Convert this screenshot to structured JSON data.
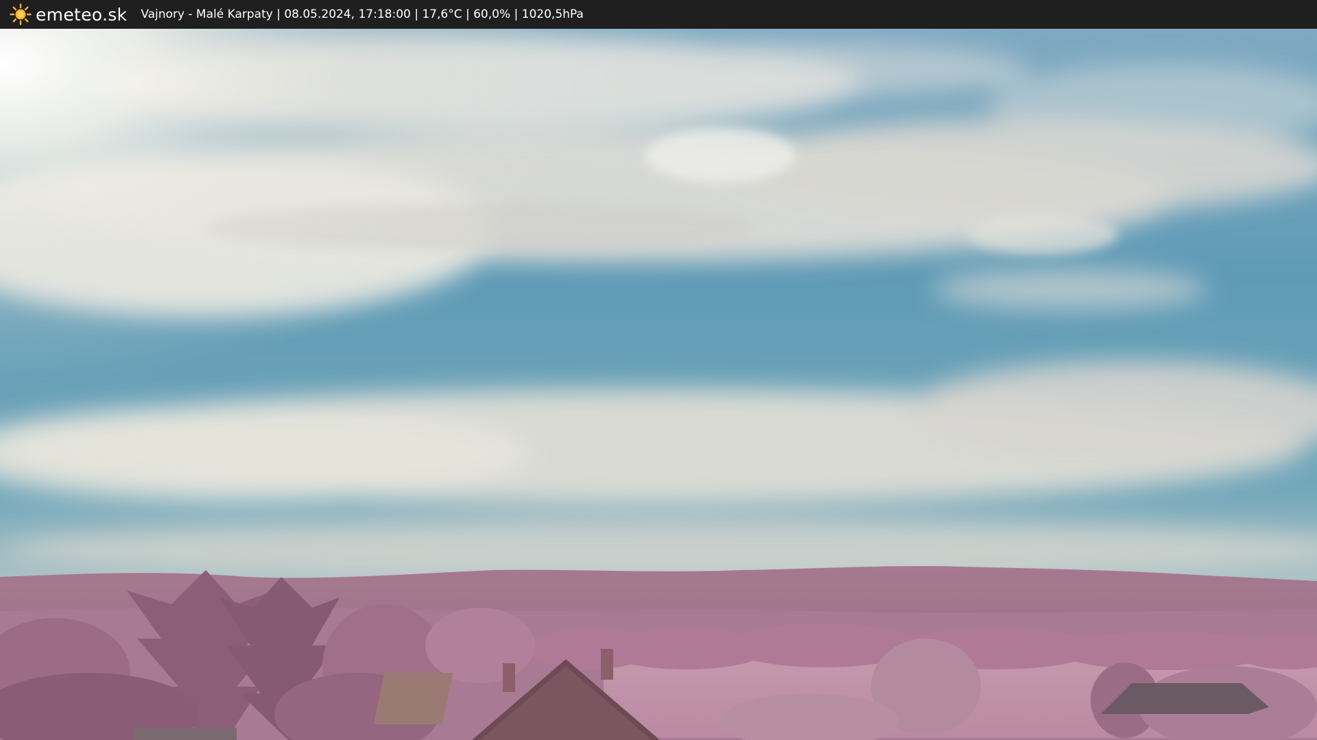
{
  "header": {
    "brand": "emeteo.sk",
    "logo_icon": "sun-icon",
    "info_line": "Vajnory - Malé Karpaty | 08.05.2024, 17:18:00 | 17,6°C | 60,0% | 1020,5hPa"
  },
  "colors": {
    "bar_background": "#1f1f1f",
    "sun_yellow": "#f7b52b",
    "sky_blue": "#5d9bb5",
    "foliage_pink": "#b07a97"
  }
}
